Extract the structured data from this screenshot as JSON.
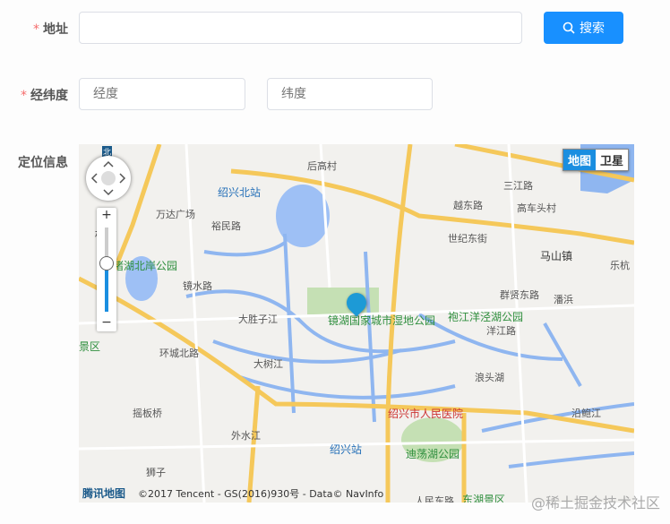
{
  "form": {
    "address": {
      "label": "地址",
      "value": "",
      "placeholder": ""
    },
    "search_button": "搜索",
    "coords": {
      "label": "经纬度",
      "lng_placeholder": "经度",
      "lat_placeholder": "纬度"
    },
    "location_label": "定位信息"
  },
  "map": {
    "type_options": [
      "地图",
      "卫星"
    ],
    "selected_type": "地图",
    "compass": "北",
    "zoom_in": "+",
    "zoom_out": "−",
    "zoom_level_fraction": 0.4,
    "logo": "腾讯地图",
    "copyright": "©2017 Tencent - GS(2016)930号 - Data© NavInfo",
    "labels": [
      {
        "t": "后高村",
        "c": ""
      },
      {
        "t": "绍兴北站",
        "c": "b"
      },
      {
        "t": "万达广场",
        "c": ""
      },
      {
        "t": "裕民路",
        "c": ""
      },
      {
        "t": "桥区",
        "c": "k"
      },
      {
        "t": "瓜渚湖北岸公园",
        "c": "g"
      },
      {
        "t": "镜水路",
        "c": ""
      },
      {
        "t": "大胜子江",
        "c": ""
      },
      {
        "t": "镜湖国家城市湿地公园",
        "c": "g"
      },
      {
        "t": "大树江",
        "c": ""
      },
      {
        "t": "越东路",
        "c": ""
      },
      {
        "t": "世纪东街",
        "c": ""
      },
      {
        "t": "马山镇",
        "c": "k"
      },
      {
        "t": "乐杭",
        "c": ""
      },
      {
        "t": "三江路",
        "c": ""
      },
      {
        "t": "高车头村",
        "c": ""
      },
      {
        "t": "群贤东路",
        "c": ""
      },
      {
        "t": "袍江洋泾湖公园",
        "c": "g"
      },
      {
        "t": "潘浜",
        "c": ""
      },
      {
        "t": "洋江路",
        "c": ""
      },
      {
        "t": "绍兴市人民医院",
        "c": "r"
      },
      {
        "t": "摇板桥",
        "c": ""
      },
      {
        "t": "外水江",
        "c": ""
      },
      {
        "t": "绍兴站",
        "c": "b"
      },
      {
        "t": "迪荡湖公园",
        "c": "g"
      },
      {
        "t": "东湖景区",
        "c": "g"
      },
      {
        "t": "人民东路",
        "c": ""
      },
      {
        "t": "沿鲍江",
        "c": ""
      },
      {
        "t": "景区",
        "c": "g"
      },
      {
        "t": "狮子",
        "c": ""
      },
      {
        "t": "环城北路",
        "c": ""
      },
      {
        "t": "浪头湖",
        "c": ""
      }
    ]
  },
  "watermark": "@稀土掘金技术社区"
}
